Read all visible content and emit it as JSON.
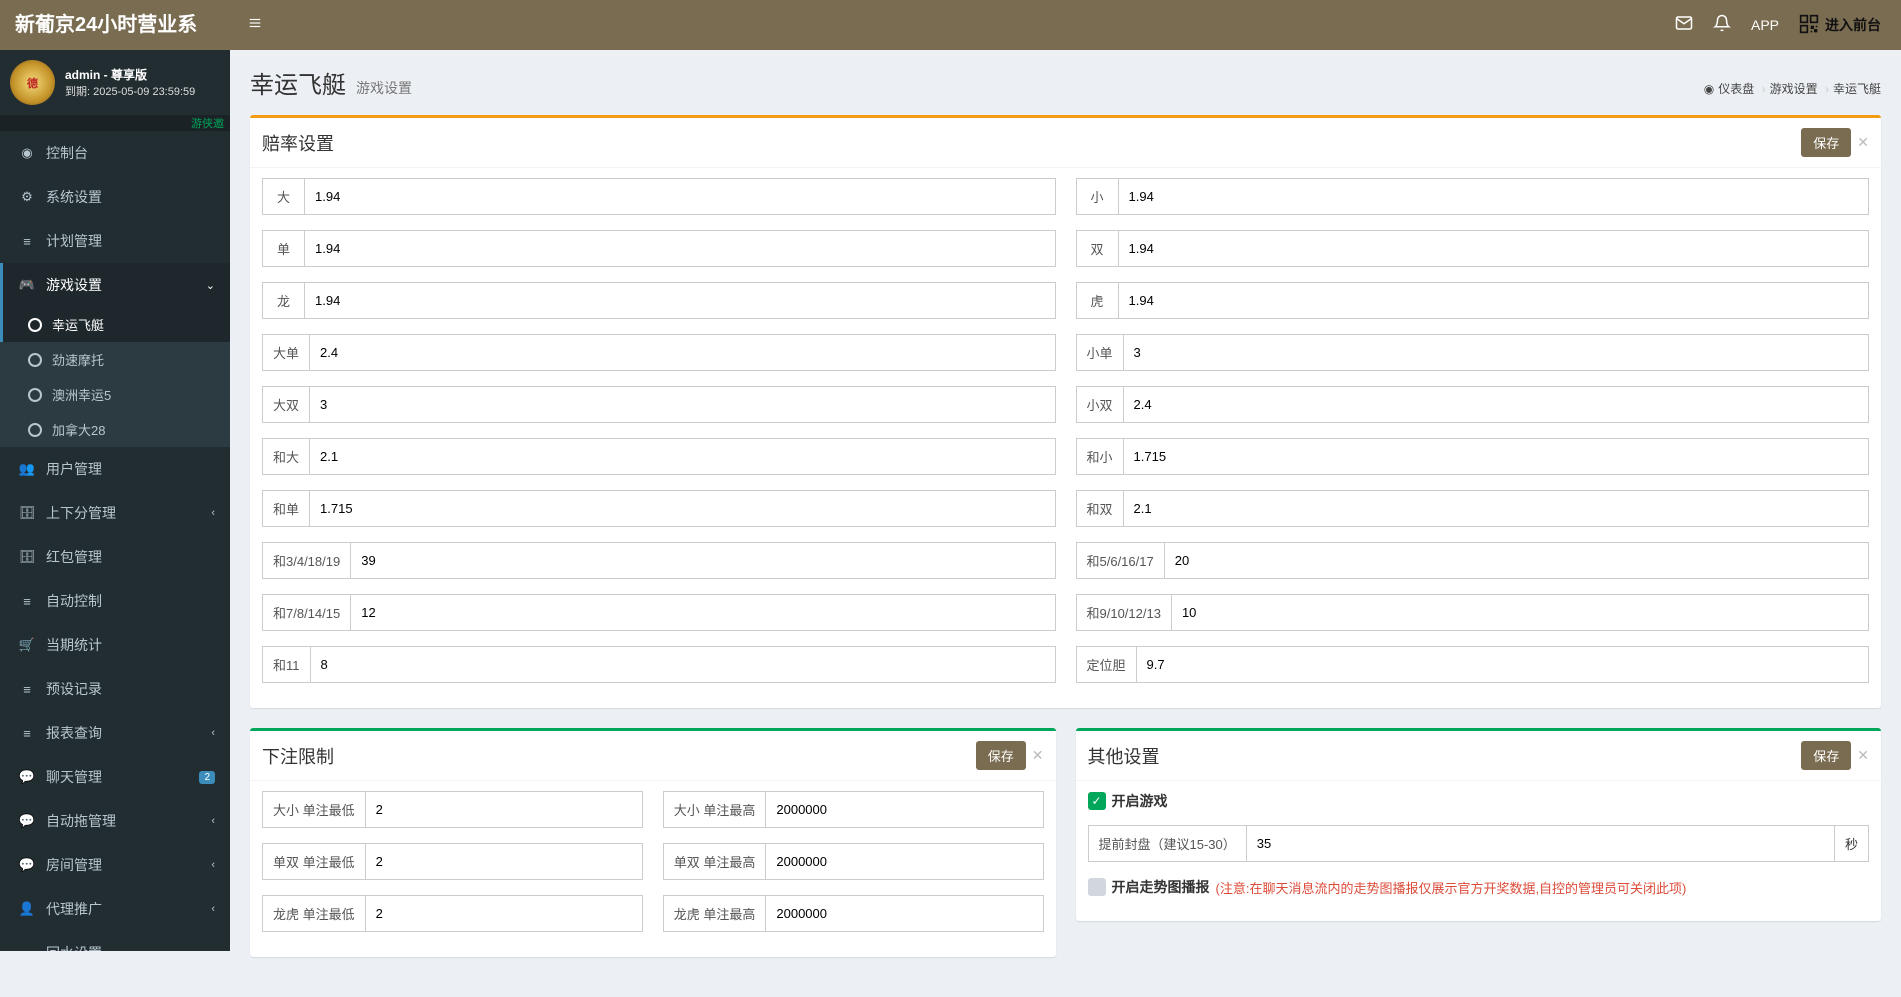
{
  "nav": {
    "logo": "新葡京24小时营业系",
    "app": "APP",
    "frontend": "进入前台"
  },
  "user": {
    "name": "admin - 尊享版",
    "expire_label": "到期:",
    "expire": "2025-05-09 23:59:59",
    "marquee": "游侠邀"
  },
  "menu": {
    "console": "控制台",
    "system": "系统设置",
    "plan": "计划管理",
    "game": "游戏设置",
    "game_sub": {
      "xyft": "幸运飞艇",
      "jsmt": "劲速摩托",
      "azxy5": "澳洲幸运5",
      "jnd28": "加拿大28"
    },
    "users": "用户管理",
    "score": "上下分管理",
    "bonus": "红包管理",
    "auto": "自动控制",
    "period": "当期统计",
    "preset": "预设记录",
    "report": "报表查询",
    "chat": "聊天管理",
    "chat_badge": "2",
    "autotuo": "自动拖管理",
    "room": "房间管理",
    "agent": "代理推广",
    "huishui": "回水设置"
  },
  "header": {
    "title": "幸运飞艇",
    "subtitle": "游戏设置",
    "crumb1": "仪表盘",
    "crumb2": "游戏设置",
    "crumb3": "幸运飞艇"
  },
  "btn": {
    "save": "保存"
  },
  "odds": {
    "title": "赔率设置",
    "left": [
      {
        "label": "大",
        "value": "1.94"
      },
      {
        "label": "单",
        "value": "1.94"
      },
      {
        "label": "龙",
        "value": "1.94"
      },
      {
        "label": "大单",
        "value": "2.4"
      },
      {
        "label": "大双",
        "value": "3"
      },
      {
        "label": "和大",
        "value": "2.1"
      },
      {
        "label": "和单",
        "value": "1.715"
      },
      {
        "label": "和3/4/18/19",
        "value": "39"
      },
      {
        "label": "和7/8/14/15",
        "value": "12"
      },
      {
        "label": "和11",
        "value": "8"
      }
    ],
    "right": [
      {
        "label": "小",
        "value": "1.94"
      },
      {
        "label": "双",
        "value": "1.94"
      },
      {
        "label": "虎",
        "value": "1.94"
      },
      {
        "label": "小单",
        "value": "3"
      },
      {
        "label": "小双",
        "value": "2.4"
      },
      {
        "label": "和小",
        "value": "1.715"
      },
      {
        "label": "和双",
        "value": "2.1"
      },
      {
        "label": "和5/6/16/17",
        "value": "20"
      },
      {
        "label": "和9/10/12/13",
        "value": "10"
      },
      {
        "label": "定位胆",
        "value": "9.7"
      }
    ]
  },
  "limits": {
    "title": "下注限制",
    "rows": [
      {
        "left_label": "大小 单注最低",
        "left_value": "2",
        "right_label": "大小 单注最高",
        "right_value": "2000000"
      },
      {
        "left_label": "单双 单注最低",
        "left_value": "2",
        "right_label": "单双 单注最高",
        "right_value": "2000000"
      },
      {
        "left_label": "龙虎 单注最低",
        "left_value": "2",
        "right_label": "龙虎 单注最高",
        "right_value": "2000000"
      }
    ]
  },
  "other": {
    "title": "其他设置",
    "enable_game": "开启游戏",
    "pre_close_label": "提前封盘（建议15-30）",
    "pre_close_value": "35",
    "pre_close_suffix": "秒",
    "trend_label": "开启走势图播报",
    "trend_note": "(注意:在聊天消息流内的走势图播报仅展示官方开奖数据,自控的管理员可关闭此项)"
  }
}
